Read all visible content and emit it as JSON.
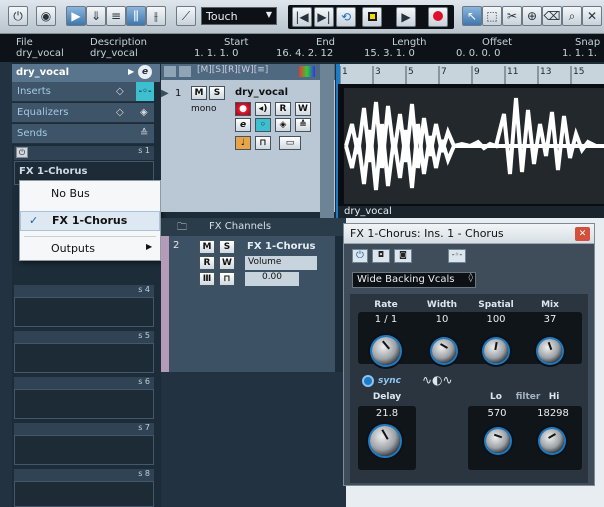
{
  "toolbar": {
    "automation_mode": "Touch"
  },
  "info_line": {
    "headers": [
      "File",
      "Description",
      "Start",
      "End",
      "Length",
      "Offset",
      "Snap"
    ],
    "values": [
      "dry_vocal",
      "dry_vocal",
      "1. 1. 1. 0",
      "16. 4. 2. 12",
      "15. 3. 1. 0",
      "0. 0. 0. 0",
      "1. 1. 1."
    ]
  },
  "inspector": {
    "track_name": "dry_vocal",
    "inserts_label": "Inserts",
    "equalizers_label": "Equalizers",
    "sends_label": "Sends",
    "send1": {
      "slot_label": "s 1",
      "value": "FX 1-Chorus"
    },
    "slots": [
      "s 4",
      "s 5",
      "s 6",
      "s 7",
      "s 8"
    ]
  },
  "context_menu": {
    "items": [
      "No Bus",
      "FX 1-Chorus",
      "Outputs"
    ],
    "checked": "✓"
  },
  "track": {
    "number": "1",
    "name": "dry_vocal",
    "mode": "mono",
    "m": "M",
    "s": "S",
    "r": "R",
    "w": "W"
  },
  "fx_folder": {
    "label": "FX Channels"
  },
  "fx_track": {
    "number": "2",
    "name": "FX 1-Chorus",
    "param": "Volume",
    "value": "0.00",
    "m": "M",
    "s": "S",
    "r": "R",
    "w": "W"
  },
  "event": {
    "label": "dry_vocal"
  },
  "plugin": {
    "title": "FX 1-Chorus: Ins. 1 - Chorus",
    "preset": "Wide Backing Vcals",
    "labels": {
      "rate": "Rate",
      "width": "Width",
      "spatial": "Spatial",
      "mix": "Mix",
      "delay": "Delay",
      "lo": "Lo",
      "filter": "filter",
      "hi": "Hi",
      "sync": "sync"
    },
    "values": {
      "rate": "1 / 1",
      "width": "10",
      "spatial": "100",
      "mix": "37",
      "delay": "21.8",
      "lo": "570",
      "hi": "18298"
    }
  },
  "ruler": {
    "marks": [
      "1",
      "3",
      "5",
      "7",
      "9",
      "11",
      "13",
      "15"
    ]
  },
  "colors": {
    "accent": "#1c7cc6",
    "inspector_header": "#59758d",
    "record": "#e0102a",
    "event_bg": "#0a0e12"
  }
}
